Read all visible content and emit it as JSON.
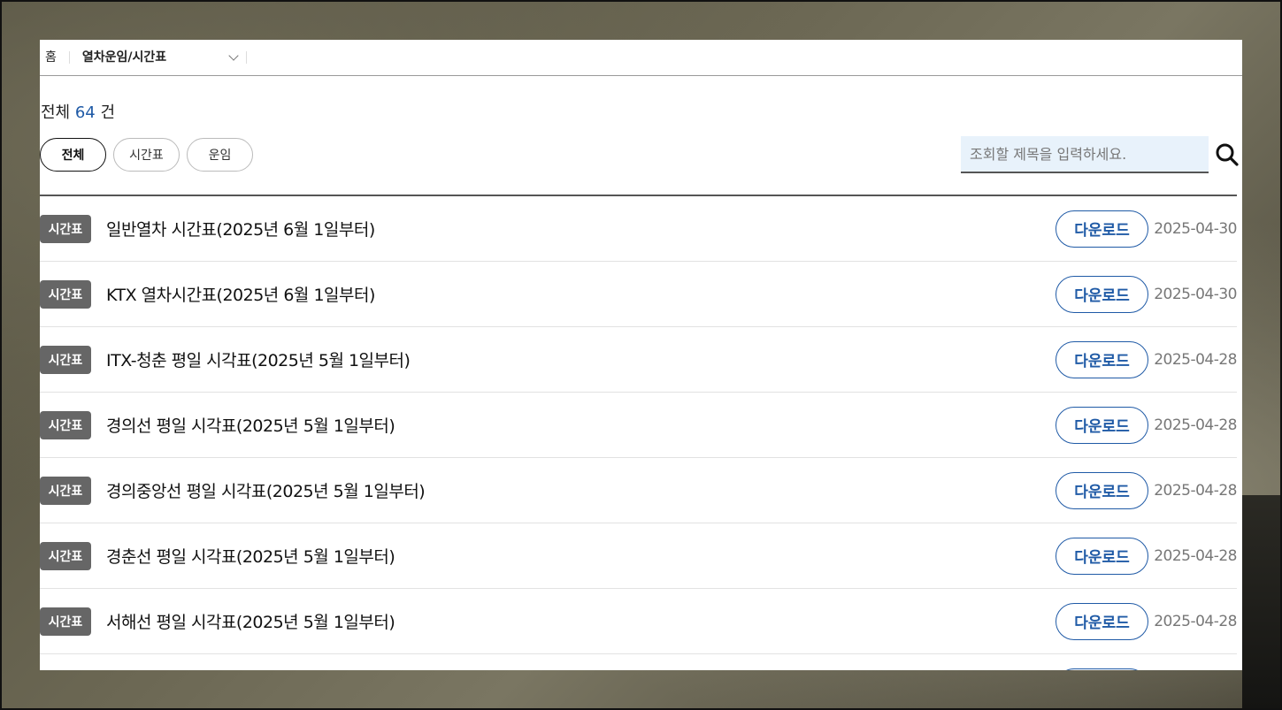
{
  "breadcrumb": {
    "home": "홈",
    "current": "열차운임/시간표"
  },
  "summary": {
    "prefix": "전체",
    "count": "64",
    "suffix": "건"
  },
  "filters": [
    "전체",
    "시간표",
    "운임"
  ],
  "search": {
    "placeholder": "조회할 제목을 입력하세요.",
    "icon": "search-icon"
  },
  "posts": [
    {
      "tag": "시간표",
      "title": "일반열차 시간표(2025년 6월 1일부터)",
      "button": "다운로드",
      "date": "2025-04-30"
    },
    {
      "tag": "시간표",
      "title": "KTX 열차시간표(2025년 6월 1일부터)",
      "button": "다운로드",
      "date": "2025-04-30"
    },
    {
      "tag": "시간표",
      "title": "ITX-청춘 평일 시각표(2025년 5월 1일부터)",
      "button": "다운로드",
      "date": "2025-04-28"
    },
    {
      "tag": "시간표",
      "title": "경의선 평일 시각표(2025년 5월 1일부터)",
      "button": "다운로드",
      "date": "2025-04-28"
    },
    {
      "tag": "시간표",
      "title": "경의중앙선 평일 시각표(2025년 5월 1일부터)",
      "button": "다운로드",
      "date": "2025-04-28"
    },
    {
      "tag": "시간표",
      "title": "경춘선 평일 시각표(2025년 5월 1일부터)",
      "button": "다운로드",
      "date": "2025-04-28"
    },
    {
      "tag": "시간표",
      "title": "서해선 평일 시각표(2025년 5월 1일부터)",
      "button": "다운로드",
      "date": "2025-04-28"
    }
  ],
  "colors": {
    "accent": "#1f5aa6",
    "tag_bg": "#666666"
  }
}
